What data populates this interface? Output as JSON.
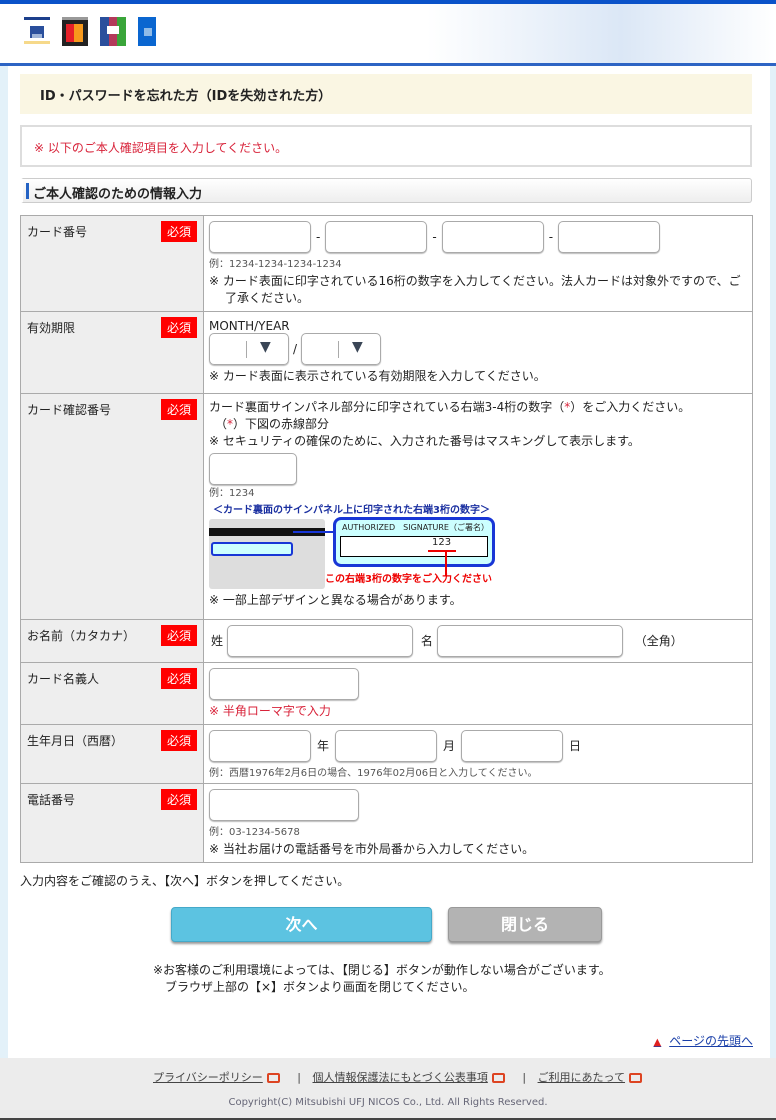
{
  "header": {
    "logos": [
      "jcb-style-logo",
      "mastercard-logo",
      "nicos-logo",
      "dc-logo"
    ]
  },
  "title": "ID・パスワードを忘れた方（IDを失効された方）",
  "notice": "※ 以下のご本人確認項目を入力してください。",
  "section": "ご本人確認のための情報入力",
  "required": "必須",
  "rows": {
    "card": {
      "label": "カード番号",
      "example": "例：1234-1234-1234-1234",
      "note": "※ カード表面に印字されている16桁の数字を入力してください。法人カードは対象外ですので、ご了承ください。",
      "sep": "-"
    },
    "expiry": {
      "label": "有効期限",
      "format": "MONTH/YEAR",
      "slash": "/",
      "note": "※ カード表面に表示されている有効期限を入力してください。"
    },
    "cvv": {
      "label": "カード確認番号",
      "line1a": "カード裏面サインパネル部分に印字されている右端3-4桁の数字（",
      "ast": "*",
      "line1b": "）をご入力ください。",
      "line2a": "（",
      "line2b": "）下図の赤線部分",
      "note": "※ セキュリティの確保のために、入力された番号はマスキングして表示します。",
      "example": "例：1234",
      "img_caption": "＜カード裏面のサインパネル上に印字された右端3桁の数字＞",
      "img_sig": "AUTHORIZED　SIGNATURE（ご署名）",
      "img_num": "123",
      "img_hint": "この右端3桁の数字をご入力ください",
      "img_note": "※ 一部上部デザインと異なる場合があります。"
    },
    "name": {
      "label": "お名前（カタカナ）",
      "sei": "姓",
      "mei": "名",
      "suffix": "（全角）"
    },
    "holder": {
      "label": "カード名義人",
      "note": "※ 半角ローマ字で入力"
    },
    "dob": {
      "label": "生年月日（西暦）",
      "y": "年",
      "m": "月",
      "d": "日",
      "example": "例：西暦1976年2月6日の場合、1976年02月06日と入力してください。"
    },
    "phone": {
      "label": "電話番号",
      "example": "例：03-1234-5678",
      "note": "※ 当社お届けの電話番号を市外局番から入力してください。"
    }
  },
  "confirm_text": "入力内容をご確認のうえ、【次へ】ボタンを押してください。",
  "buttons": {
    "next": "次へ",
    "close": "閉じる"
  },
  "warning": [
    "※お客様のご利用環境によっては、【閉じる】ボタンが動作しない場合がございます。",
    "ブラウザ上部の【×】ボタンより画面を閉じてください。"
  ],
  "page_top": "ページの先頭へ",
  "footer": {
    "links": [
      "プライバシーポリシー",
      "個人情報保護法にもとづく公表事項",
      "ご利用にあたって"
    ],
    "divider": "|",
    "copyright": "Copyright(C) Mitsubishi UFJ NICOS Co., Ltd. All Rights Reserved."
  }
}
